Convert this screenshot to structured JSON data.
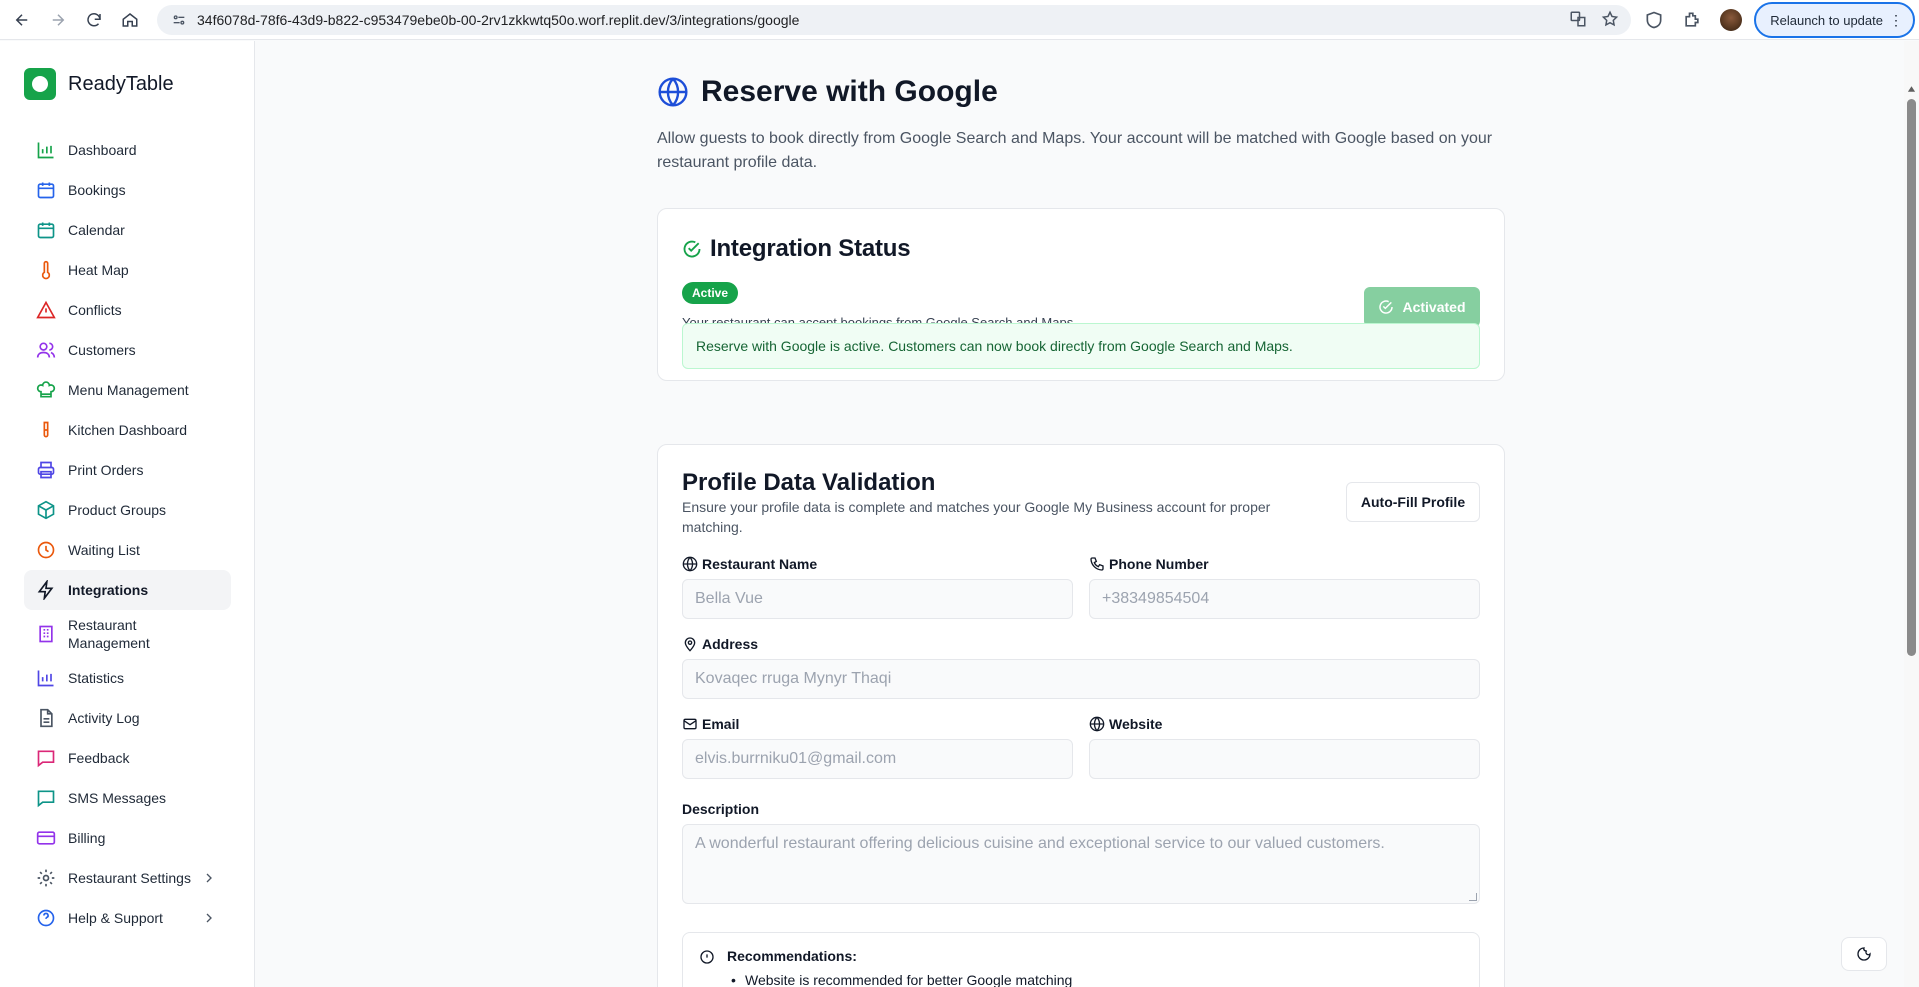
{
  "browser": {
    "url": "34f6078d-78f6-43d9-b822-c953479ebe0b-00-2rv1zkkwtq50o.worf.replit.dev/3/integrations/google",
    "relaunch_label": "Relaunch to update"
  },
  "brand": {
    "name": "ReadyTable",
    "color": "#16a34a"
  },
  "sidebar": {
    "items": [
      {
        "label": "Dashboard",
        "icon": "bar-chart-icon",
        "color": "#16a34a"
      },
      {
        "label": "Bookings",
        "icon": "calendar-icon",
        "color": "#2563eb"
      },
      {
        "label": "Calendar",
        "icon": "calendar-grid-icon",
        "color": "#0d9488"
      },
      {
        "label": "Heat Map",
        "icon": "thermometer-icon",
        "color": "#ea580c"
      },
      {
        "label": "Conflicts",
        "icon": "warning-icon",
        "color": "#dc2626"
      },
      {
        "label": "Customers",
        "icon": "users-icon",
        "color": "#9333ea"
      },
      {
        "label": "Menu Management",
        "icon": "chef-hat-icon",
        "color": "#16a34a"
      },
      {
        "label": "Kitchen Dashboard",
        "icon": "test-tube-icon",
        "color": "#ea580c"
      },
      {
        "label": "Print Orders",
        "icon": "printer-icon",
        "color": "#4f46e5"
      },
      {
        "label": "Product Groups",
        "icon": "package-icon",
        "color": "#0d9488"
      },
      {
        "label": "Waiting List",
        "icon": "clock-icon",
        "color": "#ea580c"
      },
      {
        "label": "Integrations",
        "icon": "lightning-icon",
        "color": "#111827"
      },
      {
        "label": "Restaurant Management",
        "icon": "building-icon",
        "color": "#9333ea"
      },
      {
        "label": "Statistics",
        "icon": "bar-chart-icon",
        "color": "#4f46e5"
      },
      {
        "label": "Activity Log",
        "icon": "document-icon",
        "color": "#4b5563"
      },
      {
        "label": "Feedback",
        "icon": "message-icon",
        "color": "#db2777"
      },
      {
        "label": "SMS Messages",
        "icon": "message-icon",
        "color": "#0d9488"
      },
      {
        "label": "Billing",
        "icon": "credit-card-icon",
        "color": "#9333ea"
      },
      {
        "label": "Restaurant Settings",
        "icon": "gear-icon",
        "color": "#4b5563"
      },
      {
        "label": "Help & Support",
        "icon": "help-circle-icon",
        "color": "#2563eb"
      }
    ]
  },
  "page": {
    "title": "Reserve with Google",
    "description": "Allow guests to book directly from Google Search and Maps. Your account will be matched with Google based on your restaurant profile data."
  },
  "status_card": {
    "title": "Integration Status",
    "badge": "Active",
    "status_text": "Your restaurant can accept bookings from Google Search and Maps",
    "button_label": "Activated",
    "alert": "Reserve with Google is active. Customers can now book directly from Google Search and Maps."
  },
  "profile_card": {
    "title": "Profile Data Validation",
    "description": "Ensure your profile data is complete and matches your Google My Business account for proper matching.",
    "autofill_label": "Auto-Fill Profile",
    "fields": {
      "restaurant_name": {
        "label": "Restaurant Name",
        "value": "Bella Vue"
      },
      "phone": {
        "label": "Phone Number",
        "value": "+38349854504"
      },
      "address": {
        "label": "Address",
        "value": "Kovaqec rruga Mynyr Thaqi"
      },
      "email": {
        "label": "Email",
        "value": "elvis.burrniku01@gmail.com"
      },
      "website": {
        "label": "Website",
        "value": ""
      },
      "description": {
        "label": "Description",
        "value": "A wonderful restaurant offering delicious cuisine and exceptional service to our valued customers."
      }
    },
    "recommendations": {
      "title": "Recommendations:",
      "items": [
        "Website is recommended for better Google matching"
      ]
    }
  }
}
